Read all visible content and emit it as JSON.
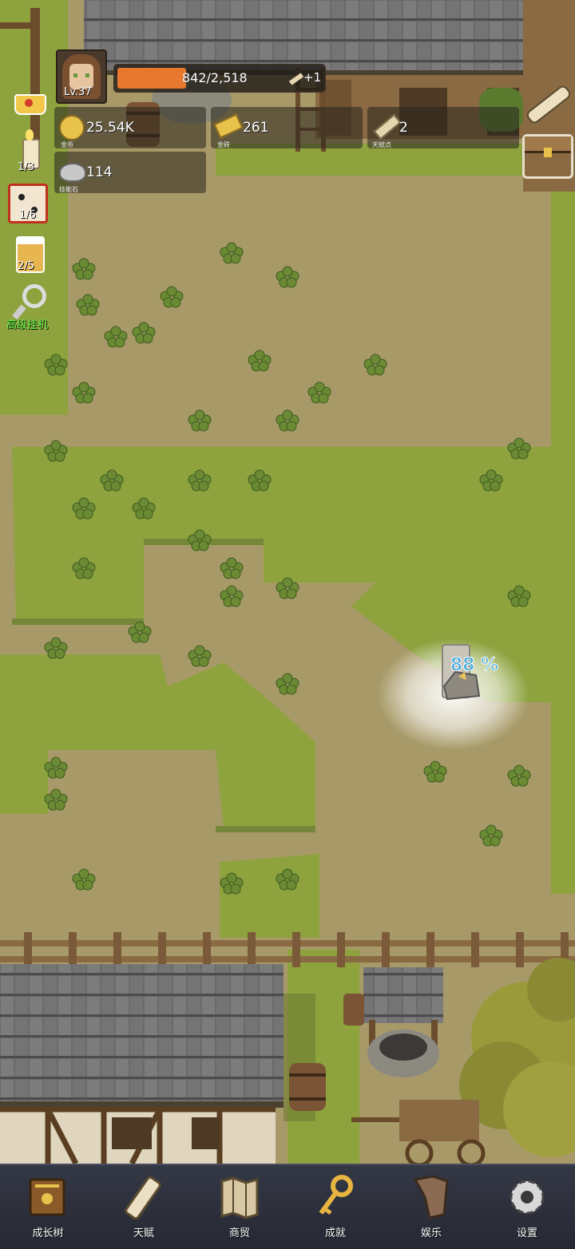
{
  "player": {
    "level": "Lv.37"
  },
  "exp_bar": {
    "text": "842/2,518",
    "bonus": "+1",
    "progress": 0.334
  },
  "resources": [
    {
      "icon": "gold-coin-icon",
      "value": "25.54K",
      "label": "金币"
    },
    {
      "icon": "gold-brick-icon",
      "value": "261",
      "label": "金砖"
    },
    {
      "icon": "talent-scroll-icon",
      "value": "2",
      "label": "天赋点"
    },
    {
      "icon": "skill-stone-icon",
      "value": "114",
      "label": "技能石"
    }
  ],
  "side_menu": {
    "candle_count": "1/3",
    "dice_count": "1/6",
    "beer_count": "2/5",
    "idle_label": "高级挂机"
  },
  "mining": {
    "percent": "88 %",
    "progress": 0.88
  },
  "nav": [
    {
      "label": "成长树",
      "icon": "book-icon"
    },
    {
      "label": "天赋",
      "icon": "scroll-icon"
    },
    {
      "label": "商贸",
      "icon": "map-icon"
    },
    {
      "label": "成就",
      "icon": "key-icon"
    },
    {
      "label": "娱乐",
      "icon": "cloth-icon"
    },
    {
      "label": "设置",
      "icon": "gear-icon"
    }
  ],
  "colors": {
    "grass": "#8ea23e",
    "dirt": "#a89a68",
    "exp_fill": "#e8782e",
    "nav_bg": "#2c303b",
    "mining_text": "#45a8d8"
  }
}
